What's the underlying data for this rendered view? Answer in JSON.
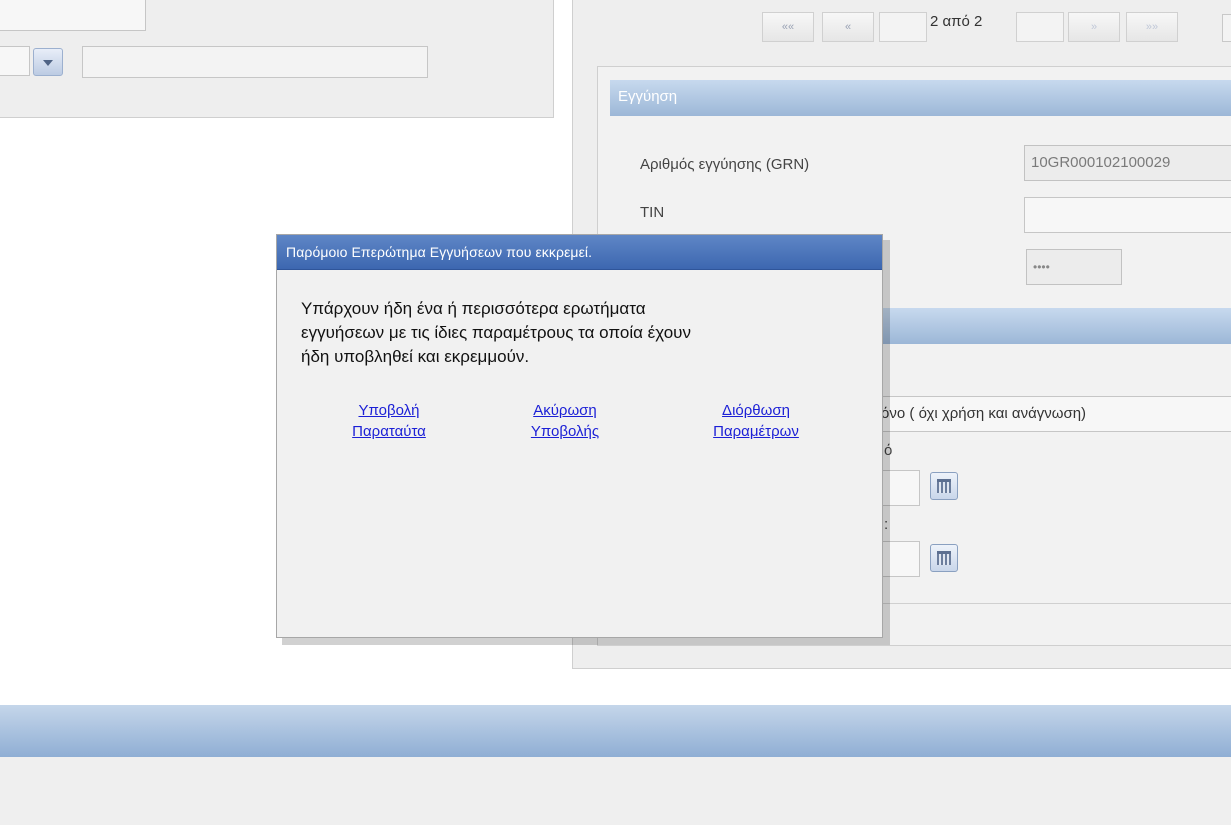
{
  "pager": {
    "first_label": "««",
    "prev_label": "«",
    "page_info": "2 από 2",
    "next_label": "»",
    "last_label": "»»"
  },
  "guarantee_section": {
    "header": "Εγγύηση",
    "grn_label": "Αριθμός εγγύησης (GRN)",
    "grn_value": "10GR000102100029",
    "tin_label": "TIN",
    "tin_value": "",
    "code_value": "••••"
  },
  "usage_option_text": "ίες μόνο ( όχι χρήση και ανάγνωση)",
  "date_label_fragment": "ό",
  "date_label_fragment_2": ":",
  "modal": {
    "title": "Παρόμοιο Επερώτημα Εγγυήσεων που εκκρεμεί.",
    "message_line1": "Υπάρχουν ήδη ένα ή περισσότερα ερωτήματα",
    "message_line2": "εγγυήσεων με τις ίδιες παραμέτρους τα οποία έχουν",
    "message_line3": "ήδη υποβληθεί και εκρεμμούν.",
    "actions": [
      {
        "line1": "Υποβολή",
        "line2": "Παραταύτα"
      },
      {
        "line1": "Ακύρωση",
        "line2": "Υποβολής"
      },
      {
        "line1": "Διόρθωση",
        "line2": "Παραμέτρων"
      }
    ]
  },
  "colors": {
    "modal_title_bg": "#4a74ba",
    "section_header_bg": "#a9c2df",
    "link_color": "#1b1fd6"
  }
}
